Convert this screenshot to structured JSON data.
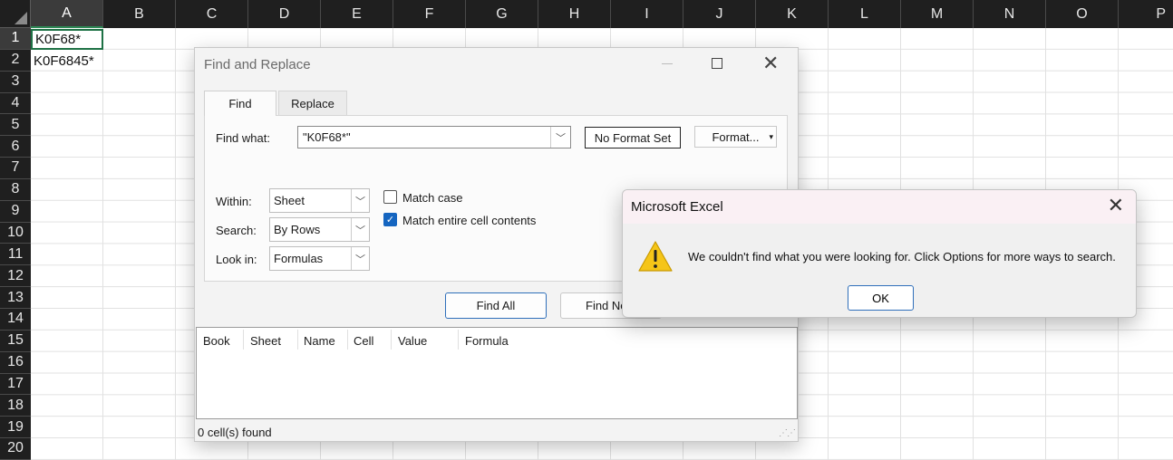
{
  "spreadsheet": {
    "columns": [
      "A",
      "B",
      "C",
      "D",
      "E",
      "F",
      "G",
      "H",
      "I",
      "J",
      "K",
      "L",
      "M",
      "N",
      "O",
      "P"
    ],
    "rows": [
      "1",
      "2",
      "3",
      "4",
      "5",
      "6",
      "7",
      "8",
      "9",
      "10",
      "11",
      "12",
      "13",
      "14",
      "15",
      "16",
      "17",
      "18",
      "19",
      "20"
    ],
    "selected_column": "A",
    "selected_row": "1",
    "cells": [
      {
        "ref": "A1",
        "value": "K0F68*"
      },
      {
        "ref": "A2",
        "value": "K0F6845*"
      }
    ]
  },
  "find_replace": {
    "title": "Find and Replace",
    "tabs": [
      {
        "label": "Find",
        "active": true
      },
      {
        "label": "Replace",
        "active": false
      }
    ],
    "find_what_label": "Find what:",
    "find_what_value": "\"K0F68*\"",
    "no_format_label": "No Format Set",
    "format_button_label": "Format...",
    "within_label": "Within:",
    "within_value": "Sheet",
    "search_label": "Search:",
    "search_value": "By Rows",
    "look_in_label": "Look in:",
    "look_in_value": "Formulas",
    "match_case_label": "Match case",
    "match_case_checked": false,
    "match_entire_label": "Match entire cell contents",
    "match_entire_checked": true,
    "find_all_label": "Find All",
    "find_next_label": "Find Ne",
    "results_columns": [
      "Book",
      "Sheet",
      "Name",
      "Cell",
      "Value",
      "Formula"
    ],
    "status_text": "0 cell(s) found"
  },
  "alert": {
    "title": "Microsoft Excel",
    "message": "We couldn't find what you were looking for. Click Options for more ways to search.",
    "ok_label": "OK",
    "icon": "warning-icon",
    "icon_color": "#f5c518"
  },
  "colors": {
    "header_bg": "#1f1f1f",
    "accent_green": "#1e7145",
    "accent_blue": "#1565c0"
  }
}
